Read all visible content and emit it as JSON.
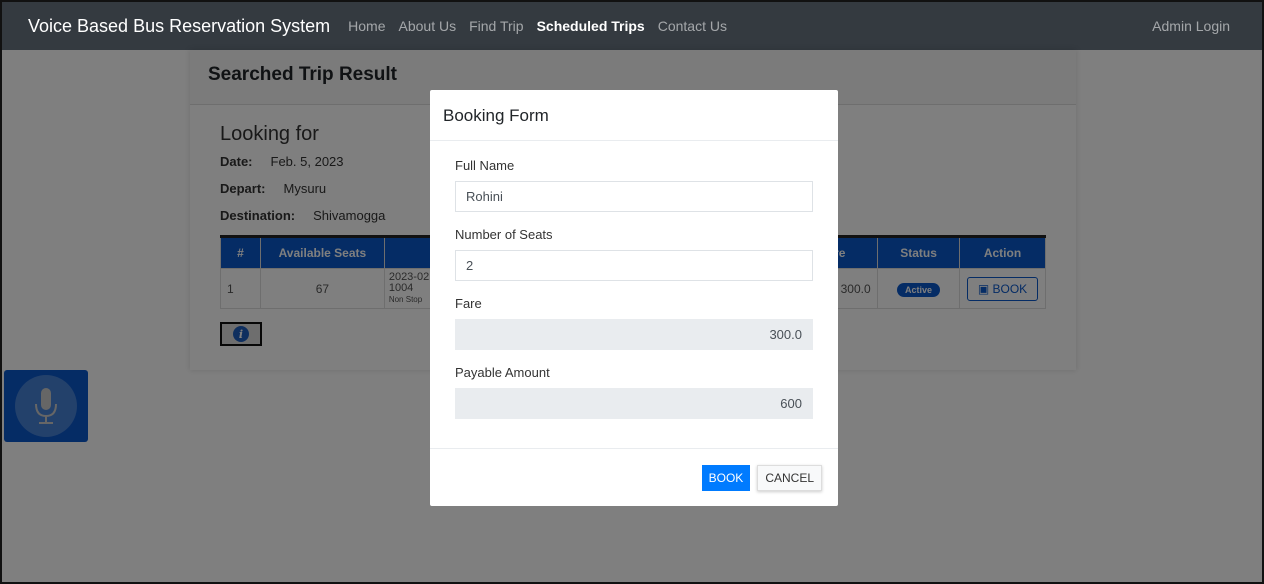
{
  "navbar": {
    "brand": "Voice Based Bus Reservation System",
    "links": [
      {
        "label": "Home",
        "active": false
      },
      {
        "label": "About Us",
        "active": false
      },
      {
        "label": "Find Trip",
        "active": false
      },
      {
        "label": "Scheduled Trips",
        "active": true
      },
      {
        "label": "Contact Us",
        "active": false
      }
    ],
    "admin_login": "Admin Login"
  },
  "card": {
    "title": "Searched Trip Result",
    "looking_for": "Looking for",
    "date_label": "Date:",
    "date_value": "Feb. 5, 2023",
    "depart_label": "Depart:",
    "depart_value": "Mysuru",
    "destination_label": "Destination:",
    "destination_value": "Shivamogga"
  },
  "table": {
    "headers": [
      "#",
      "Available Seats",
      "",
      "re",
      "Status",
      "Action"
    ],
    "rows": [
      {
        "num": "1",
        "seats": "67",
        "schedule_date": "2023-02",
        "schedule_code": "1004",
        "schedule_type": "Non Stop",
        "fare": "300.0",
        "status": "Active",
        "action": "BOOK"
      }
    ]
  },
  "modal": {
    "title": "Booking Form",
    "full_name_label": "Full Name",
    "full_name_value": "Rohini",
    "seats_label": "Number of Seats",
    "seats_value": "2",
    "fare_label": "Fare",
    "fare_value": "300.0",
    "payable_label": "Payable Amount",
    "payable_value": "600",
    "book_label": "BOOK",
    "cancel_label": "CANCEL"
  },
  "colors": {
    "navbar": "#343a40",
    "primary": "#007bff",
    "table_header": "#0a58ca"
  }
}
